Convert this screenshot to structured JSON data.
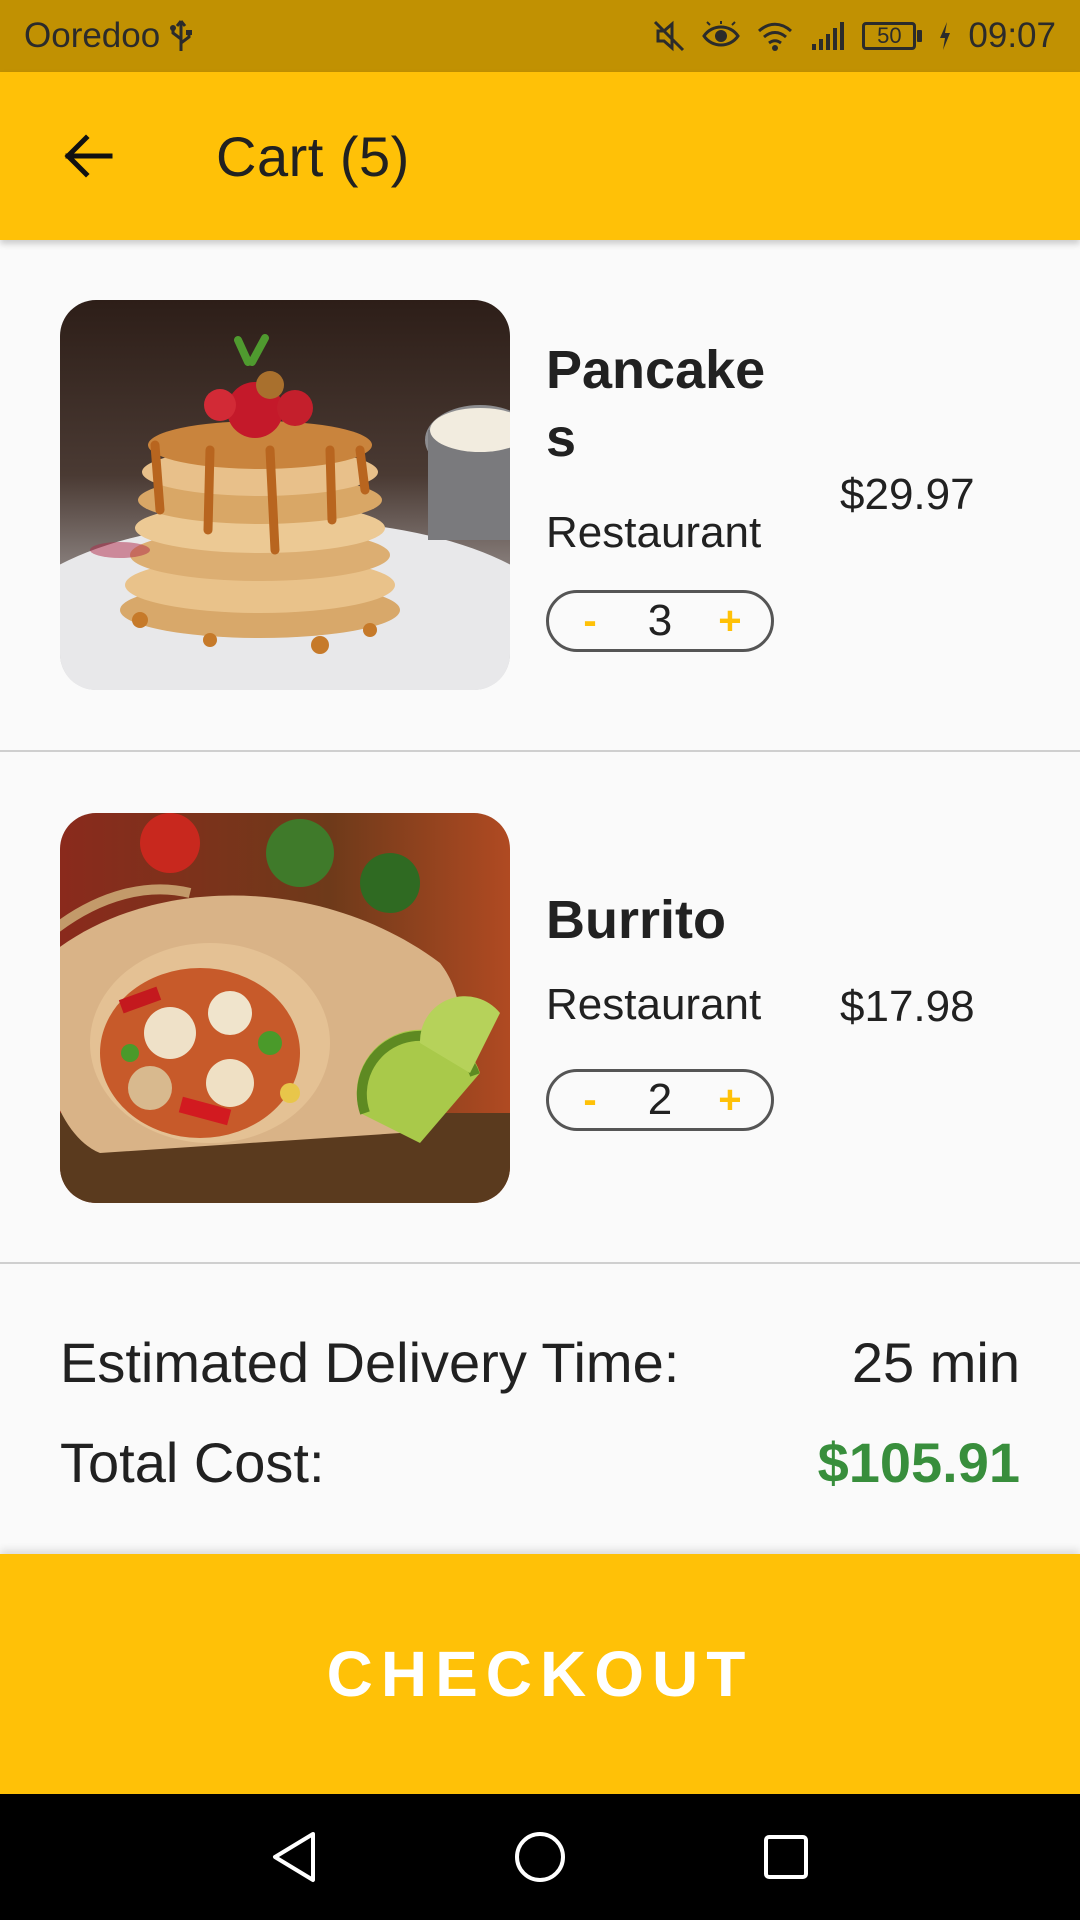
{
  "status_bar": {
    "carrier": "Ooredoo",
    "battery": "50",
    "time": "09:07"
  },
  "app_bar": {
    "title": "Cart (5)"
  },
  "cart": {
    "items": [
      {
        "name": "Pancakes",
        "restaurant": "Restaurant",
        "quantity": "3",
        "price": "$29.97",
        "decrement": "-",
        "increment": "+"
      },
      {
        "name": "Burrito",
        "restaurant": "Restaurant",
        "quantity": "2",
        "price": "$17.98",
        "decrement": "-",
        "increment": "+"
      }
    ]
  },
  "summary": {
    "delivery_label": "Estimated Delivery Time:",
    "delivery_value": "25 min",
    "total_label": "Total Cost:",
    "total_value": "$105.91"
  },
  "checkout": {
    "label": "CHECKOUT"
  },
  "colors": {
    "primary": "#ffc107",
    "status_bar": "#c19102",
    "total": "#388e3c"
  },
  "icons": {
    "back": "arrow-left-icon",
    "usb": "usb-icon",
    "mute": "mute-icon",
    "eye": "eye-icon",
    "wifi": "wifi-icon",
    "signal": "signal-icon",
    "charging": "charging-icon",
    "nav_back": "nav-back-icon",
    "nav_home": "nav-home-icon",
    "nav_recents": "nav-recents-icon"
  }
}
